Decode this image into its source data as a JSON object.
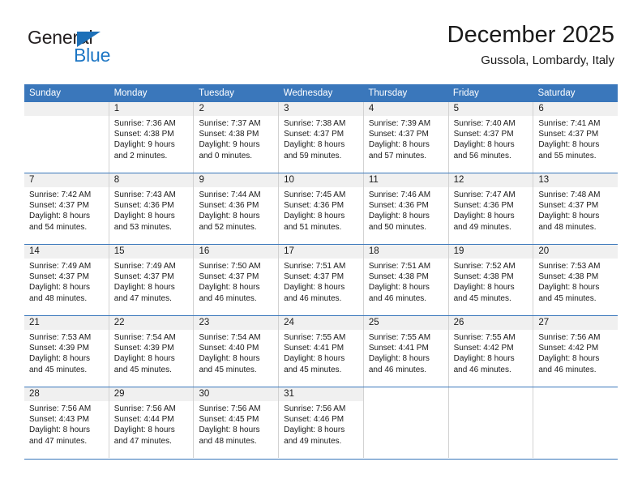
{
  "logo": {
    "text_general": "General",
    "text_blue": "Blue",
    "triangle_icon": "triangle-icon",
    "colors": {
      "general": "#231f20",
      "blue": "#1d76c4",
      "triangle": "#1d70b8"
    }
  },
  "header": {
    "title": "December 2025",
    "subtitle": "Gussola, Lombardy, Italy"
  },
  "theme": {
    "accent": "#3a77bb",
    "header_text": "#ffffff",
    "date_band": "#f0f0f0",
    "cell_border": "#d2d2d2"
  },
  "weekdays": [
    "Sunday",
    "Monday",
    "Tuesday",
    "Wednesday",
    "Thursday",
    "Friday",
    "Saturday"
  ],
  "weeks": [
    [
      {
        "date": "",
        "sunrise": "",
        "sunset": "",
        "daylight1": "",
        "daylight2": "",
        "empty": true
      },
      {
        "date": "1",
        "sunrise": "Sunrise: 7:36 AM",
        "sunset": "Sunset: 4:38 PM",
        "daylight1": "Daylight: 9 hours",
        "daylight2": "and 2 minutes."
      },
      {
        "date": "2",
        "sunrise": "Sunrise: 7:37 AM",
        "sunset": "Sunset: 4:38 PM",
        "daylight1": "Daylight: 9 hours",
        "daylight2": "and 0 minutes."
      },
      {
        "date": "3",
        "sunrise": "Sunrise: 7:38 AM",
        "sunset": "Sunset: 4:37 PM",
        "daylight1": "Daylight: 8 hours",
        "daylight2": "and 59 minutes."
      },
      {
        "date": "4",
        "sunrise": "Sunrise: 7:39 AM",
        "sunset": "Sunset: 4:37 PM",
        "daylight1": "Daylight: 8 hours",
        "daylight2": "and 57 minutes."
      },
      {
        "date": "5",
        "sunrise": "Sunrise: 7:40 AM",
        "sunset": "Sunset: 4:37 PM",
        "daylight1": "Daylight: 8 hours",
        "daylight2": "and 56 minutes."
      },
      {
        "date": "6",
        "sunrise": "Sunrise: 7:41 AM",
        "sunset": "Sunset: 4:37 PM",
        "daylight1": "Daylight: 8 hours",
        "daylight2": "and 55 minutes."
      }
    ],
    [
      {
        "date": "7",
        "sunrise": "Sunrise: 7:42 AM",
        "sunset": "Sunset: 4:37 PM",
        "daylight1": "Daylight: 8 hours",
        "daylight2": "and 54 minutes."
      },
      {
        "date": "8",
        "sunrise": "Sunrise: 7:43 AM",
        "sunset": "Sunset: 4:36 PM",
        "daylight1": "Daylight: 8 hours",
        "daylight2": "and 53 minutes."
      },
      {
        "date": "9",
        "sunrise": "Sunrise: 7:44 AM",
        "sunset": "Sunset: 4:36 PM",
        "daylight1": "Daylight: 8 hours",
        "daylight2": "and 52 minutes."
      },
      {
        "date": "10",
        "sunrise": "Sunrise: 7:45 AM",
        "sunset": "Sunset: 4:36 PM",
        "daylight1": "Daylight: 8 hours",
        "daylight2": "and 51 minutes."
      },
      {
        "date": "11",
        "sunrise": "Sunrise: 7:46 AM",
        "sunset": "Sunset: 4:36 PM",
        "daylight1": "Daylight: 8 hours",
        "daylight2": "and 50 minutes."
      },
      {
        "date": "12",
        "sunrise": "Sunrise: 7:47 AM",
        "sunset": "Sunset: 4:36 PM",
        "daylight1": "Daylight: 8 hours",
        "daylight2": "and 49 minutes."
      },
      {
        "date": "13",
        "sunrise": "Sunrise: 7:48 AM",
        "sunset": "Sunset: 4:37 PM",
        "daylight1": "Daylight: 8 hours",
        "daylight2": "and 48 minutes."
      }
    ],
    [
      {
        "date": "14",
        "sunrise": "Sunrise: 7:49 AM",
        "sunset": "Sunset: 4:37 PM",
        "daylight1": "Daylight: 8 hours",
        "daylight2": "and 48 minutes."
      },
      {
        "date": "15",
        "sunrise": "Sunrise: 7:49 AM",
        "sunset": "Sunset: 4:37 PM",
        "daylight1": "Daylight: 8 hours",
        "daylight2": "and 47 minutes."
      },
      {
        "date": "16",
        "sunrise": "Sunrise: 7:50 AM",
        "sunset": "Sunset: 4:37 PM",
        "daylight1": "Daylight: 8 hours",
        "daylight2": "and 46 minutes."
      },
      {
        "date": "17",
        "sunrise": "Sunrise: 7:51 AM",
        "sunset": "Sunset: 4:37 PM",
        "daylight1": "Daylight: 8 hours",
        "daylight2": "and 46 minutes."
      },
      {
        "date": "18",
        "sunrise": "Sunrise: 7:51 AM",
        "sunset": "Sunset: 4:38 PM",
        "daylight1": "Daylight: 8 hours",
        "daylight2": "and 46 minutes."
      },
      {
        "date": "19",
        "sunrise": "Sunrise: 7:52 AM",
        "sunset": "Sunset: 4:38 PM",
        "daylight1": "Daylight: 8 hours",
        "daylight2": "and 45 minutes."
      },
      {
        "date": "20",
        "sunrise": "Sunrise: 7:53 AM",
        "sunset": "Sunset: 4:38 PM",
        "daylight1": "Daylight: 8 hours",
        "daylight2": "and 45 minutes."
      }
    ],
    [
      {
        "date": "21",
        "sunrise": "Sunrise: 7:53 AM",
        "sunset": "Sunset: 4:39 PM",
        "daylight1": "Daylight: 8 hours",
        "daylight2": "and 45 minutes."
      },
      {
        "date": "22",
        "sunrise": "Sunrise: 7:54 AM",
        "sunset": "Sunset: 4:39 PM",
        "daylight1": "Daylight: 8 hours",
        "daylight2": "and 45 minutes."
      },
      {
        "date": "23",
        "sunrise": "Sunrise: 7:54 AM",
        "sunset": "Sunset: 4:40 PM",
        "daylight1": "Daylight: 8 hours",
        "daylight2": "and 45 minutes."
      },
      {
        "date": "24",
        "sunrise": "Sunrise: 7:55 AM",
        "sunset": "Sunset: 4:41 PM",
        "daylight1": "Daylight: 8 hours",
        "daylight2": "and 45 minutes."
      },
      {
        "date": "25",
        "sunrise": "Sunrise: 7:55 AM",
        "sunset": "Sunset: 4:41 PM",
        "daylight1": "Daylight: 8 hours",
        "daylight2": "and 46 minutes."
      },
      {
        "date": "26",
        "sunrise": "Sunrise: 7:55 AM",
        "sunset": "Sunset: 4:42 PM",
        "daylight1": "Daylight: 8 hours",
        "daylight2": "and 46 minutes."
      },
      {
        "date": "27",
        "sunrise": "Sunrise: 7:56 AM",
        "sunset": "Sunset: 4:42 PM",
        "daylight1": "Daylight: 8 hours",
        "daylight2": "and 46 minutes."
      }
    ],
    [
      {
        "date": "28",
        "sunrise": "Sunrise: 7:56 AM",
        "sunset": "Sunset: 4:43 PM",
        "daylight1": "Daylight: 8 hours",
        "daylight2": "and 47 minutes."
      },
      {
        "date": "29",
        "sunrise": "Sunrise: 7:56 AM",
        "sunset": "Sunset: 4:44 PM",
        "daylight1": "Daylight: 8 hours",
        "daylight2": "and 47 minutes."
      },
      {
        "date": "30",
        "sunrise": "Sunrise: 7:56 AM",
        "sunset": "Sunset: 4:45 PM",
        "daylight1": "Daylight: 8 hours",
        "daylight2": "and 48 minutes."
      },
      {
        "date": "31",
        "sunrise": "Sunrise: 7:56 AM",
        "sunset": "Sunset: 4:46 PM",
        "daylight1": "Daylight: 8 hours",
        "daylight2": "and 49 minutes."
      },
      {
        "date": "",
        "sunrise": "",
        "sunset": "",
        "daylight1": "",
        "daylight2": "",
        "blank": true
      },
      {
        "date": "",
        "sunrise": "",
        "sunset": "",
        "daylight1": "",
        "daylight2": "",
        "blank": true
      },
      {
        "date": "",
        "sunrise": "",
        "sunset": "",
        "daylight1": "",
        "daylight2": "",
        "blank": true
      }
    ]
  ]
}
